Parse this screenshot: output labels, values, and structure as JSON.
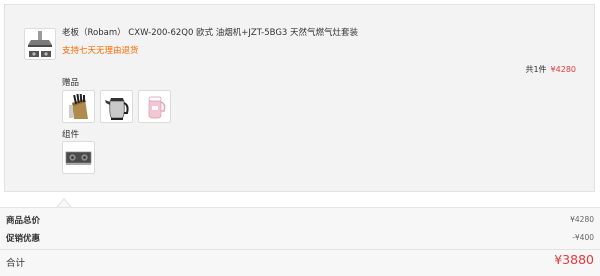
{
  "product": {
    "title": "老板（Robam） CXW-200-62Q0 欧式 油烟机+JZT-5BG3 天然气燃气灶套装",
    "promise": "支持七天无理由退货",
    "count_text": "共1件",
    "price": "¥4280"
  },
  "gifts": {
    "label": "赠品",
    "items": [
      {
        "icon": "knife-block-icon"
      },
      {
        "icon": "electric-kettle-icon"
      },
      {
        "icon": "soymilk-maker-icon"
      }
    ]
  },
  "components": {
    "label": "组件",
    "items": [
      {
        "icon": "gas-stove-icon"
      }
    ]
  },
  "summary": {
    "subtotal_label": "商品总价",
    "subtotal_value": "¥4280",
    "discount_label": "促销优惠",
    "discount_value": "-¥400",
    "total_label": "合计",
    "total_value": "¥3880"
  },
  "colors": {
    "accent": "#e4393c",
    "promise": "#ff6a00"
  }
}
